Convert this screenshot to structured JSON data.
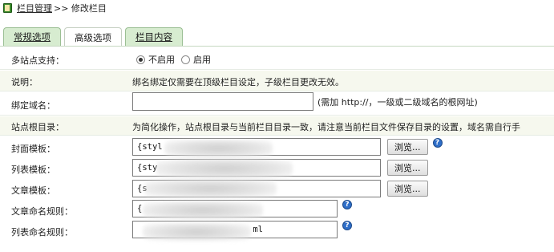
{
  "breadcrumb": {
    "link": "栏目管理",
    "rest": ">> 修改栏目"
  },
  "tabs": [
    {
      "label": "常规选项"
    },
    {
      "label": "高级选项"
    },
    {
      "label": "栏目内容"
    }
  ],
  "form": {
    "multisite": {
      "label": "多站点支持：",
      "options": [
        "不启用",
        "启用"
      ],
      "selected": "不启用"
    },
    "note": {
      "label": "说明：",
      "text": "绑名绑定仅需要在顶级栏目设定，子级栏目更改无效。"
    },
    "domain": {
      "label": "绑定域名：",
      "value": "",
      "hint": "(需加 http://，一级或二级域名的根网址)"
    },
    "rootdir": {
      "label": "站点根目录：",
      "text": "为简化操作，站点根目录与当前栏目目录一致，请注意当前栏目文件保存目录的设置，域名需自行手"
    },
    "cover_tpl": {
      "label": "封面模板：",
      "value": "{styl",
      "browse": "浏览..."
    },
    "list_tpl": {
      "label": "列表模板：",
      "value": "{sty",
      "browse": "浏览..."
    },
    "article_tpl": {
      "label": "文章模板：",
      "value": "{s",
      "browse": "浏览..."
    },
    "article_rule": {
      "label": "文章命名规则：",
      "value": "{"
    },
    "list_rule": {
      "label": "列表命名规则：",
      "value": "ml"
    }
  },
  "colors": {
    "tab_green": "#d7ecd0",
    "row_alt": "#f6f8ee",
    "help_icon": "#2f6fc9"
  }
}
